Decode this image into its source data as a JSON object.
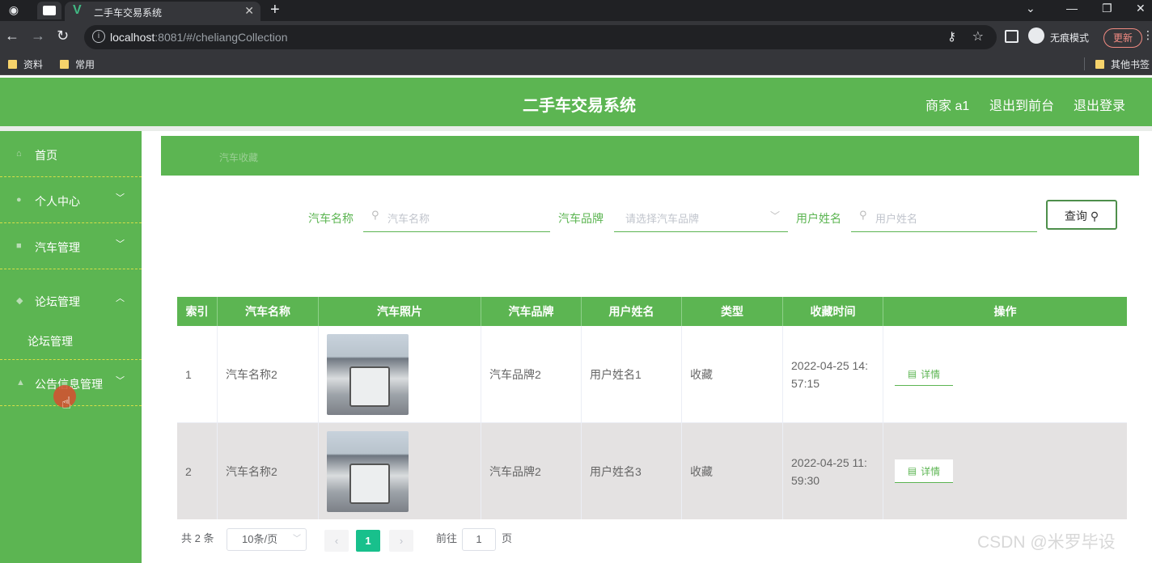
{
  "browser": {
    "tab_title": "二手车交易系统",
    "tab_logo": "V",
    "url_host": "localhost",
    "url_rest": ":8081/#/cheliangCollection",
    "incognito_label": "无痕模式",
    "update_label": "更新",
    "bookmarks": [
      "资料",
      "常用"
    ],
    "other_bookmarks": "其他书签"
  },
  "header": {
    "title": "二手车交易系统",
    "user": "商家 a1",
    "back_front": "退出到前台",
    "logout": "退出登录"
  },
  "sidebar": {
    "items": [
      {
        "label": "首页"
      },
      {
        "label": "个人中心",
        "chevron": "﹀"
      },
      {
        "label": "汽车管理",
        "chevron": "﹀"
      },
      {
        "label": "论坛管理",
        "chevron": "︿"
      },
      {
        "label": "论坛管理"
      },
      {
        "label": "公告信息管理",
        "chevron": "﹀"
      }
    ]
  },
  "breadcrumb": "汽车收藏",
  "filters": {
    "car_name": {
      "label": "汽车名称",
      "placeholder": "汽车名称"
    },
    "brand": {
      "label": "汽车品牌",
      "placeholder": "请选择汽车品牌"
    },
    "user": {
      "label": "用户姓名",
      "placeholder": "用户姓名"
    },
    "query_label": "查询"
  },
  "table": {
    "headers": [
      "索引",
      "汽车名称",
      "汽车照片",
      "汽车品牌",
      "用户姓名",
      "类型",
      "收藏时间",
      "操作"
    ],
    "rows": [
      {
        "index": "1",
        "name": "汽车名称2",
        "brand": "汽车品牌2",
        "user": "用户姓名1",
        "type": "收藏",
        "time_a": "2022-04-25 14:",
        "time_b": "57:15",
        "action": "详情"
      },
      {
        "index": "2",
        "name": "汽车名称2",
        "brand": "汽车品牌2",
        "user": "用户姓名3",
        "type": "收藏",
        "time_a": "2022-04-25 11:",
        "time_b": "59:30",
        "action": "详情"
      }
    ]
  },
  "pagination": {
    "total": "共 2 条",
    "page_size": "10条/页",
    "current": "1",
    "goto_prefix": "前往",
    "goto_value": "1",
    "goto_suffix": "页"
  },
  "watermark": "CSDN @米罗毕设",
  "colors": {
    "accent": "#5cb552",
    "page_active": "#18c08c"
  }
}
